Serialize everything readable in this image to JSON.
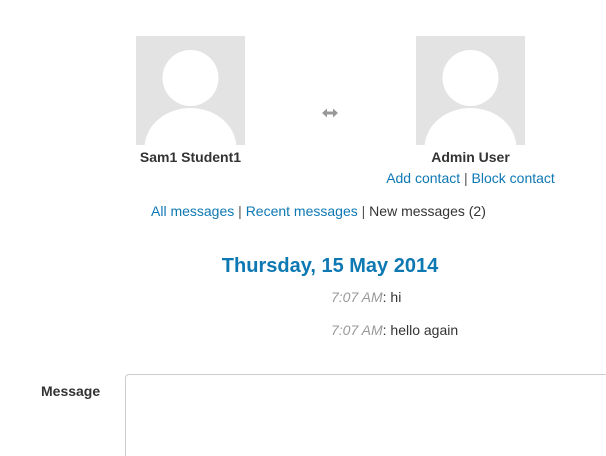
{
  "sender": {
    "name": "Sam1 Student1",
    "avatar_icon": "default-user-avatar-icon"
  },
  "recipient": {
    "name": "Admin User",
    "avatar_icon": "default-user-avatar-icon",
    "add_contact": "Add contact",
    "block_contact": "Block contact"
  },
  "swap_icon": "left-right-arrow-icon",
  "view_links": {
    "all": "All messages",
    "recent": "Recent messages",
    "new": "New messages (2)",
    "separator": "|"
  },
  "date_heading": "Thursday, 15 May 2014",
  "messages": [
    {
      "time": "7:07 AM",
      "text": ": hi"
    },
    {
      "time": "7:07 AM",
      "text": ": hello again"
    }
  ],
  "message_form": {
    "label": "Message",
    "value": ""
  },
  "colors": {
    "link": "#0e78b3",
    "avatar_bg": "#e3e3e3",
    "time": "#999999"
  }
}
